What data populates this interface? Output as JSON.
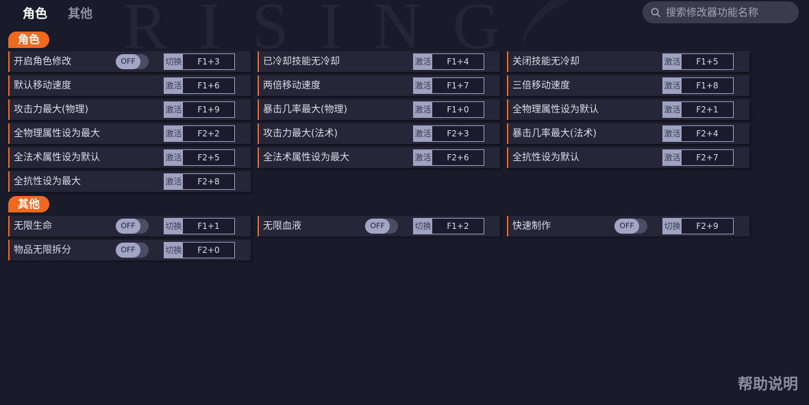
{
  "background": {
    "title_text": "RISING"
  },
  "tabs": [
    "角色",
    "其他"
  ],
  "search": {
    "placeholder": "搜索修改器功能名称"
  },
  "sections": {
    "role": {
      "title": "角色"
    },
    "other": {
      "title": "其他"
    }
  },
  "role_rows": [
    {
      "label": "开启角色修改",
      "toggle": "OFF",
      "action": "切换",
      "key": "F1+3"
    },
    {
      "label": "已冷却技能无冷却",
      "action": "激活",
      "key": "F1+4"
    },
    {
      "label": "关闭技能无冷却",
      "action": "激活",
      "key": "F1+5"
    },
    {
      "label": "默认移动速度",
      "action": "激活",
      "key": "F1+6"
    },
    {
      "label": "两倍移动速度",
      "action": "激活",
      "key": "F1+7"
    },
    {
      "label": "三倍移动速度",
      "action": "激活",
      "key": "F1+8"
    },
    {
      "label": "攻击力最大(物理)",
      "action": "激活",
      "key": "F1+9"
    },
    {
      "label": "暴击几率最大(物理)",
      "action": "激活",
      "key": "F1+0"
    },
    {
      "label": "全物理属性设为默认",
      "action": "激活",
      "key": "F2+1"
    },
    {
      "label": "全物理属性设为最大",
      "action": "激活",
      "key": "F2+2"
    },
    {
      "label": "攻击力最大(法术)",
      "action": "激活",
      "key": "F2+3"
    },
    {
      "label": "暴击几率最大(法术)",
      "action": "激活",
      "key": "F2+4"
    },
    {
      "label": "全法术属性设为默认",
      "action": "激活",
      "key": "F2+5"
    },
    {
      "label": "全法术属性设为最大",
      "action": "激活",
      "key": "F2+6"
    },
    {
      "label": "全抗性设为默认",
      "action": "激活",
      "key": "F2+7"
    },
    {
      "label": "全抗性设为最大",
      "action": "激活",
      "key": "F2+8"
    }
  ],
  "other_rows": [
    {
      "label": "无限生命",
      "toggle": "OFF",
      "action": "切换",
      "key": "F1+1"
    },
    {
      "label": "无限血液",
      "toggle": "OFF",
      "action": "切换",
      "key": "F1+2"
    },
    {
      "label": "快速制作",
      "toggle": "OFF",
      "action": "切换",
      "key": "F2+9"
    },
    {
      "label": "物品无限拆分",
      "toggle": "OFF",
      "action": "切换",
      "key": "F2+0"
    }
  ],
  "help": {
    "label": "帮助说明"
  },
  "colors": {
    "accent": "#ef6a1f",
    "background": "#191a2a",
    "row": "#252637",
    "toggle_knob": "#a2a5c4"
  }
}
